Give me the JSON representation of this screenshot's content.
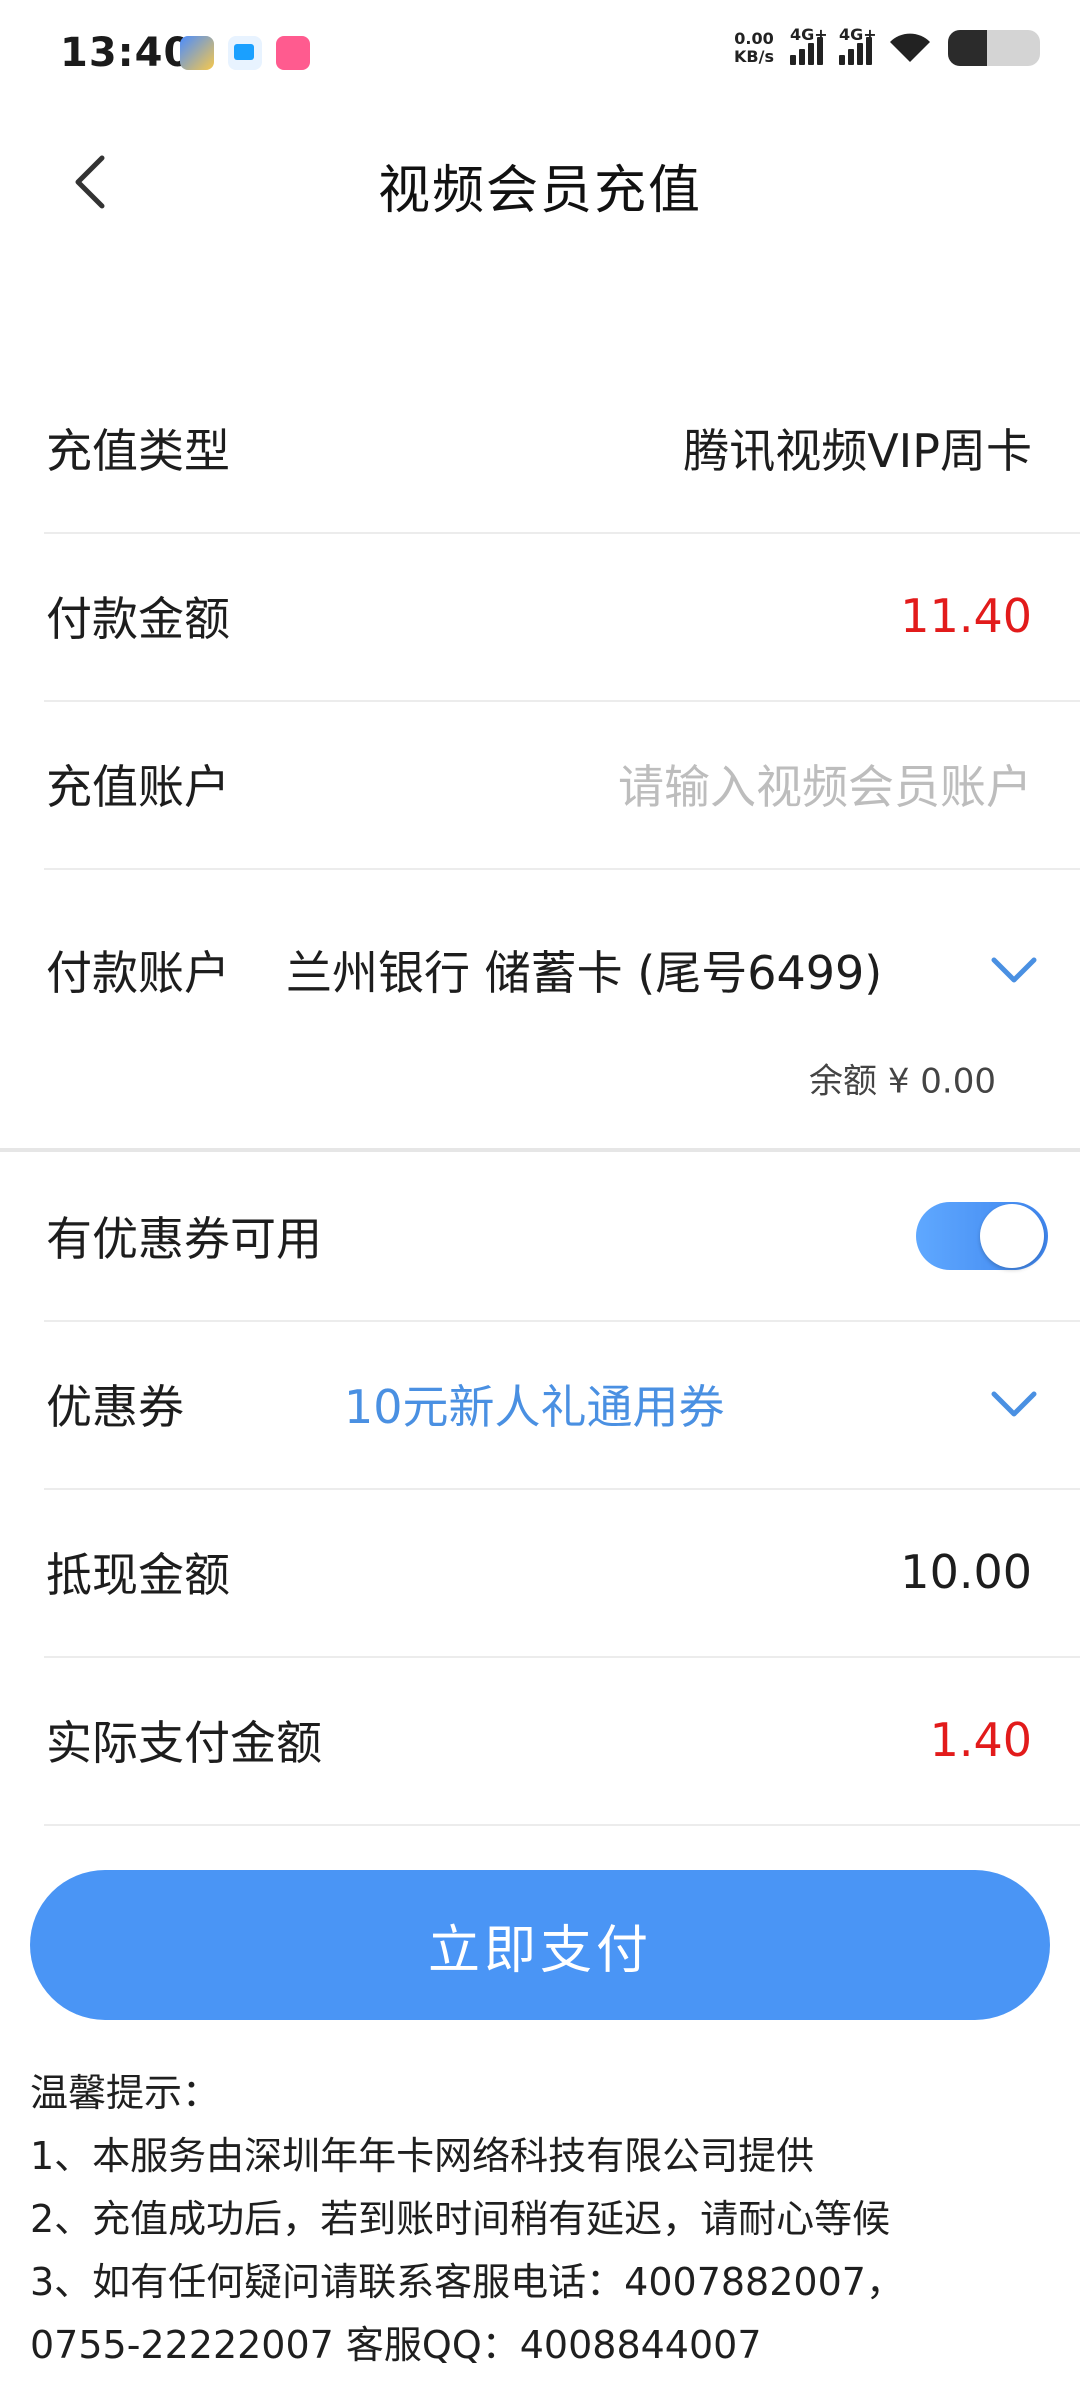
{
  "status_bar": {
    "time": "13:40",
    "net_speed_value": "0.00",
    "net_speed_unit": "KB/s",
    "signal1_label": "4G+",
    "signal2_label": "4G+"
  },
  "header": {
    "title": "视频会员充值"
  },
  "form": {
    "recharge_type_label": "充值类型",
    "recharge_type_value": "腾讯视频VIP周卡",
    "pay_amount_label": "付款金额",
    "pay_amount_value": "11.40",
    "recharge_account_label": "充值账户",
    "recharge_account_placeholder": "请输入视频会员账户",
    "pay_account_label": "付款账户",
    "pay_account_value": "兰州银行 储蓄卡 (尾号6499)",
    "balance_text": "余额 ¥  0.00",
    "coupon_available_label": "有优惠券可用",
    "coupon_label": "优惠券",
    "coupon_value": "10元新人礼通用券",
    "discount_label": "抵现金额",
    "discount_value": "10.00",
    "actual_pay_label": "实际支付金额",
    "actual_pay_value": "1.40"
  },
  "pay_button_label": "立即支付",
  "tips": {
    "title": "温馨提示：",
    "lines": [
      "1、本服务由深圳年年卡网络科技有限公司提供",
      "2、充值成功后，若到账时间稍有延迟，请耐心等候",
      "3、如有任何疑问请联系客服电话：4007882007，",
      "0755-22222007 客服QQ：4008844007"
    ]
  },
  "colors": {
    "accent_blue": "#4a95f5",
    "amount_red": "#e21b1b"
  }
}
